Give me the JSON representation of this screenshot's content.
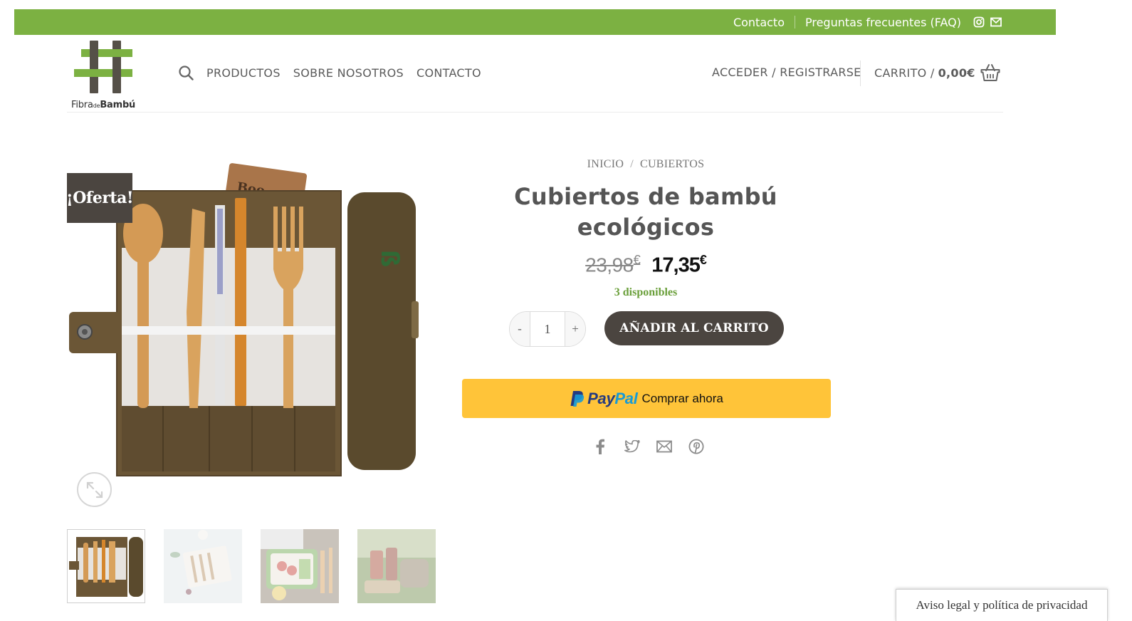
{
  "topbar": {
    "links": [
      "Contacto",
      "Preguntas frecuentes (FAQ)"
    ],
    "social_icons": [
      "instagram-icon",
      "envelope-icon"
    ],
    "background": "#7cb142"
  },
  "header": {
    "logo": {
      "word1": "Fibra",
      "word2": "de",
      "word3": "Bambú"
    },
    "nav": [
      "PRODUCTOS",
      "SOBRE NOSOTROS",
      "CONTACTO"
    ],
    "account": "ACCEDER / REGISTRARSE",
    "cart": {
      "label": "CARRITO /",
      "total": "0,00€"
    }
  },
  "gallery": {
    "badge": "¡Oferta!",
    "main_image": "bamboo-cutlery-roll",
    "thumbnails": [
      "bamboo-cutlery-roll",
      "cutlery-on-white",
      "lunchbox-with-cutlery",
      "cutlery-outdoors"
    ]
  },
  "product": {
    "breadcrumb": [
      "INICIO",
      "CUBIERTOS"
    ],
    "breadcrumb_separator": "/",
    "title": "Cubiertos de bambú ecológicos",
    "price_old": "23,98",
    "price_new": "17,35",
    "currency": "€",
    "stock": "3 disponibles",
    "quantity": "1",
    "qty_minus": "-",
    "qty_plus": "+",
    "add_to_cart": "AÑADIR AL CARRITO",
    "paypal": {
      "pay": "Pay",
      "pal": "Pal",
      "cta": "Comprar ahora"
    },
    "share_icons": [
      "facebook-icon",
      "twitter-icon",
      "email-icon",
      "pinterest-icon"
    ]
  },
  "footer": {
    "legal": "Aviso legal y política de privacidad"
  },
  "colors": {
    "accent_green": "#7cb142",
    "dark_brown": "#4b4540",
    "paypal_yellow": "#ffc439",
    "stock_green": "#6a9f3a"
  }
}
